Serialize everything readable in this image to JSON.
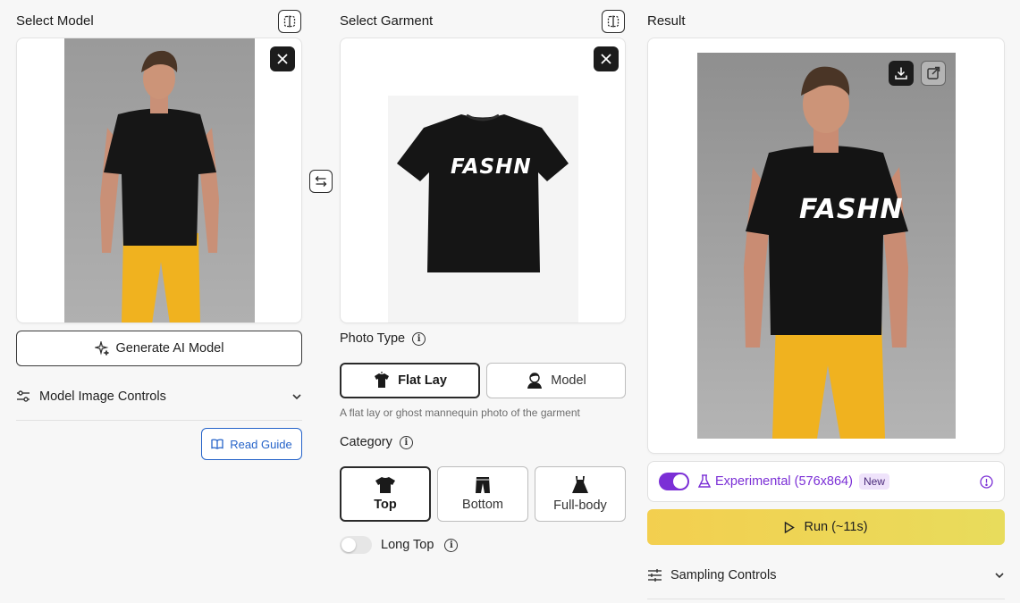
{
  "model_column": {
    "title": "Select Model",
    "generate_label": "Generate AI Model",
    "controls_label": "Model Image Controls",
    "guide_label": "Read Guide"
  },
  "garment_column": {
    "title": "Select Garment",
    "photo_type": {
      "label": "Photo Type",
      "options": [
        "Flat Lay",
        "Model"
      ],
      "selected": "Flat Lay",
      "hint": "A flat lay or ghost mannequin photo of the garment"
    },
    "category": {
      "label": "Category",
      "options": [
        "Top",
        "Bottom",
        "Full-body"
      ],
      "selected": "Top"
    },
    "long_top": {
      "label": "Long Top",
      "enabled": false
    },
    "garment_print": "FASHN"
  },
  "result_column": {
    "title": "Result",
    "experimental": {
      "label": "Experimental (576x864)",
      "badge": "New",
      "enabled": true
    },
    "run_label": "Run (~11s)",
    "sampling_label": "Sampling Controls",
    "shirt_print": "FASHN"
  },
  "colors": {
    "accent_purple": "#7b2fd6",
    "run_gradient_start": "#f3cf4f",
    "run_gradient_end": "#e8dc5c",
    "guide_blue": "#2563c9",
    "pants_yellow": "#f0b21f"
  },
  "icons": [
    "compare-icon",
    "close-icon",
    "swap-icon",
    "sparkle-icon",
    "sliders-icon",
    "chevron-down-icon",
    "book-icon",
    "info-icon",
    "shirt-icon",
    "person-icon",
    "pants-icon",
    "dress-icon",
    "download-icon",
    "external-link-icon",
    "flask-icon",
    "play-icon"
  ]
}
